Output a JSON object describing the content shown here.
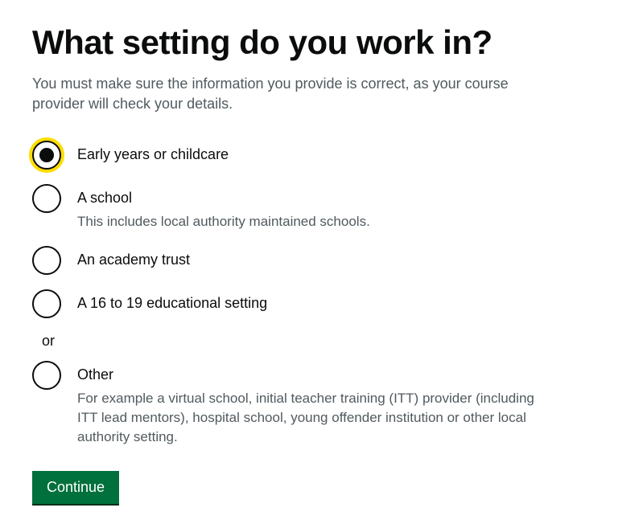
{
  "heading": "What setting do you work in?",
  "description": "You must make sure the information you provide is correct, as your course provider will check your details.",
  "options": [
    {
      "label": "Early years or childcare",
      "hint": "",
      "selected": true
    },
    {
      "label": "A school",
      "hint": "This includes local authority maintained schools.",
      "selected": false
    },
    {
      "label": "An academy trust",
      "hint": "",
      "selected": false
    },
    {
      "label": "A 16 to 19 educational setting",
      "hint": "",
      "selected": false
    }
  ],
  "divider": "or",
  "other_option": {
    "label": "Other",
    "hint": "For example a virtual school, initial teacher training (ITT) provider (including ITT lead mentors), hospital school, young offender institution or other local authority setting.",
    "selected": false
  },
  "continue_label": "Continue"
}
